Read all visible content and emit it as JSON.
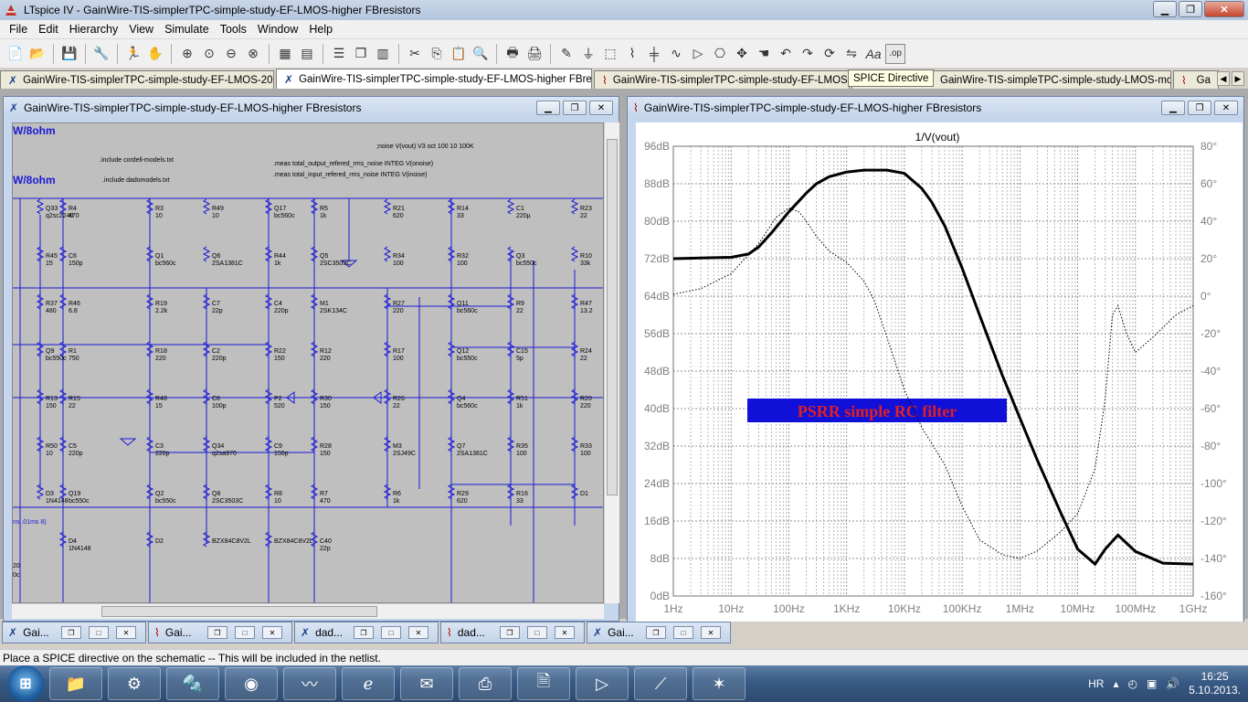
{
  "window": {
    "title": "LTspice IV - GainWire-TIS-simplerTPC-simple-study-EF-LMOS-higher FBresistors"
  },
  "menu": [
    "File",
    "Edit",
    "Hierarchy",
    "View",
    "Simulate",
    "Tools",
    "Window",
    "Help"
  ],
  "tabs": [
    "GainWire-TIS-simplerTPC-simple-study-EF-LMOS-200W",
    "GainWire-TIS-simplerTPC-simple-study-EF-LMOS-higher FBresistors",
    "GainWire-TIS-simplerTPC-simple-study-EF-LMOS-higher",
    "GainWire-TIS-simpleTPC-simple-study-LMOS-mcd99uk",
    "Ga"
  ],
  "tooltip": "SPICE Directive",
  "schematic_window": {
    "title": "GainWire-TIS-simplerTPC-simple-study-EF-LMOS-higher FBresistors",
    "directives": [
      ".include cordell-models.txt",
      ".include dadomodels.txt",
      ";noise V(vout) V3 oct 100 10 100K",
      ".meas total_output_refered_rms_noise INTEG V(onoise)",
      ".meas total_input_refered_rms_noise INTEG V(inoise)"
    ],
    "big_labels": [
      "W/8ohm",
      "W/8ohm"
    ],
    "side_labels": [
      "ns .01ms 8)",
      "20",
      "0c"
    ],
    "components": [
      [
        "R4",
        "470"
      ],
      [
        "R3",
        "10"
      ],
      [
        "R49",
        "10"
      ],
      [
        "Q17",
        "bc560c"
      ],
      [
        "R5",
        "1k"
      ],
      [
        "R21",
        "620"
      ],
      [
        "R14",
        "33"
      ],
      [
        "C1",
        "220µ"
      ],
      [
        "R23",
        "22"
      ],
      [
        "Q33",
        "q2sc2240"
      ],
      [
        "C6",
        "150p"
      ],
      [
        "Q1",
        "bc560c"
      ],
      [
        "Q6",
        "2SA1381C"
      ],
      [
        "R44",
        "1k"
      ],
      [
        "Q5",
        "2SC3503C"
      ],
      [
        "R34",
        "100"
      ],
      [
        "R32",
        "100"
      ],
      [
        "Q3",
        "bc550c"
      ],
      [
        "R10",
        "33k"
      ],
      [
        "R45",
        "15"
      ],
      [
        "R46",
        "6.8"
      ],
      [
        "R19",
        "2.2k"
      ],
      [
        "C7",
        "22p"
      ],
      [
        "C4",
        "220p"
      ],
      [
        "M1",
        "2SK134C"
      ],
      [
        "R27",
        "220"
      ],
      [
        "Q11",
        "bc560c"
      ],
      [
        "R9",
        "22"
      ],
      [
        "R47",
        "13.2"
      ],
      [
        "R37",
        "480"
      ],
      [
        "R1",
        "750"
      ],
      [
        "R18",
        "220"
      ],
      [
        "C2",
        "220p"
      ],
      [
        "R22",
        "150"
      ],
      [
        "R12",
        "220"
      ],
      [
        "R17",
        "100"
      ],
      [
        "Q12",
        "bc550c"
      ],
      [
        "C15",
        "5p"
      ],
      [
        "R24",
        "22"
      ],
      [
        "Q9",
        "bc550c"
      ],
      [
        "R15",
        "22"
      ],
      [
        "R48",
        "15"
      ],
      [
        "C8",
        "100p"
      ],
      [
        "P2",
        "520"
      ],
      [
        "R30",
        "150"
      ],
      [
        "R26",
        "22"
      ],
      [
        "Q4",
        "bc560c"
      ],
      [
        "R51",
        "1k"
      ],
      [
        "R20",
        "220"
      ],
      [
        "R13",
        "150"
      ],
      [
        "C5",
        "220p"
      ],
      [
        "C3",
        "220p"
      ],
      [
        "Q34",
        "q2sa970"
      ],
      [
        "C9",
        "150p"
      ],
      [
        "R28",
        "150"
      ],
      [
        "M3",
        "2SJ49C"
      ],
      [
        "Q7",
        "2SA1381C"
      ],
      [
        "R35",
        "100"
      ],
      [
        "R33",
        "100"
      ],
      [
        "R50",
        "10"
      ],
      [
        "Q19",
        "bc550c"
      ],
      [
        "Q2",
        "bc550c"
      ],
      [
        "Q8",
        "2SC3503C"
      ],
      [
        "R8",
        "10"
      ],
      [
        "R7",
        "470"
      ],
      [
        "R6",
        "1k"
      ],
      [
        "R29",
        "620"
      ],
      [
        "R16",
        "33"
      ],
      [
        "D1",
        ""
      ],
      [
        "D3",
        "1N4148"
      ],
      [
        "D4",
        "1N4148"
      ],
      [
        "D2",
        ""
      ],
      [
        "BZX84C8V2L",
        ""
      ],
      [
        "BZX84C8V2L",
        ""
      ],
      [
        "C40",
        "22p"
      ]
    ]
  },
  "waveform_window": {
    "title": "GainWire-TIS-simplerTPC-simple-study-EF-LMOS-higher FBresistors",
    "annotation": "PSRR simple RC filter"
  },
  "chart_data": {
    "type": "line",
    "title": "1/V(vout)",
    "x_scale": "log",
    "x_ticks": [
      "1Hz",
      "10Hz",
      "100Hz",
      "1KHz",
      "10KHz",
      "100KHz",
      "1MHz",
      "10MHz",
      "100MHz",
      "1GHz"
    ],
    "xlim_hz": [
      1,
      1000000000
    ],
    "y_ticks": [
      "0dB",
      "8dB",
      "16dB",
      "24dB",
      "32dB",
      "40dB",
      "48dB",
      "56dB",
      "64dB",
      "72dB",
      "80dB",
      "88dB",
      "96dB"
    ],
    "ylim_db": [
      0,
      96
    ],
    "y2_ticks": [
      "-160°",
      "-140°",
      "-120°",
      "-100°",
      "-80°",
      "-60°",
      "-40°",
      "-20°",
      "0°",
      "20°",
      "40°",
      "60°",
      "80°"
    ],
    "y2lim_deg": [
      -160,
      80
    ],
    "grid": true,
    "series": [
      {
        "style": "solid",
        "axis": "left",
        "x": [
          1,
          10,
          20,
          30,
          50,
          100,
          200,
          300,
          500,
          1000,
          2000,
          5000,
          10000,
          20000,
          30000,
          50000,
          100000,
          200000,
          500000,
          1000000,
          2000000,
          5000000,
          10000000,
          20000000,
          30000000,
          50000000,
          100000000,
          300000000,
          1000000000
        ],
        "y": [
          72,
          72.3,
          73,
          74.5,
          77.5,
          82,
          86,
          88,
          89.5,
          90.5,
          90.9,
          90.9,
          90.2,
          87,
          84,
          79,
          70,
          60,
          47,
          38,
          29,
          18,
          10,
          6.8,
          10,
          13,
          9.5,
          7,
          6.8
        ]
      },
      {
        "style": "dotted",
        "axis": "right",
        "x": [
          1,
          3,
          10,
          30,
          60,
          100,
          150,
          200,
          300,
          500,
          1000,
          2000,
          3000,
          5000,
          10000,
          20000,
          50000,
          100000,
          200000,
          500000,
          1000000,
          2000000,
          5000000,
          10000000,
          20000000,
          30000000,
          40000000,
          50000000,
          70000000,
          100000000,
          200000000,
          500000000,
          1000000000
        ],
        "y": [
          1,
          4,
          12,
          28,
          42,
          47,
          45,
          40,
          32,
          24,
          18,
          8,
          -2,
          -22,
          -50,
          -70,
          -90,
          -112,
          -130,
          -138,
          -140,
          -136,
          -126,
          -116,
          -92,
          -55,
          -10,
          -5,
          -20,
          -30,
          -22,
          -10,
          -5
        ]
      }
    ]
  },
  "minimized_tabs": [
    "Gai...",
    "Gai...",
    "dad...",
    "dad...",
    "Gai..."
  ],
  "status_text": "Place a SPICE directive on the schematic -- This will be included in the netlist.",
  "taskbar": {
    "lang": "HR",
    "time": "16:25",
    "date": "5.10.2013."
  }
}
